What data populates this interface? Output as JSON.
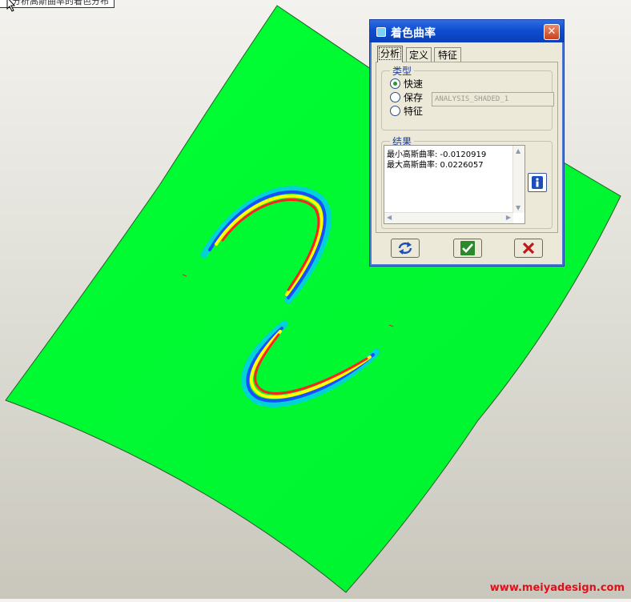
{
  "tooltip": {
    "text": "分析高斯曲率的着色分布"
  },
  "watermark": "www.meiyadesign.com",
  "colors": {
    "surface": "#00ff33",
    "title_bar": "#0f4ed0",
    "dialog_bg": "#ece9d8"
  },
  "dialog": {
    "title": "着色曲率",
    "tabs": [
      {
        "label": "分析",
        "active": true
      },
      {
        "label": "定义",
        "active": false
      },
      {
        "label": "特征",
        "active": false
      }
    ],
    "type_group": {
      "label": "类型",
      "options": [
        {
          "label": "快速",
          "checked": true
        },
        {
          "label": "保存",
          "checked": false
        },
        {
          "label": "特征",
          "checked": false
        }
      ],
      "save_name": "ANALYSIS_SHADED_1"
    },
    "results_group": {
      "label": "结果",
      "lines": [
        "最小高斯曲率: -0.0120919",
        "最大高斯曲率: 0.0226057"
      ]
    },
    "info_icon": "info-icon",
    "buttons": {
      "refresh": "refresh-icon",
      "ok": "checkmark-icon",
      "cancel": "x-icon"
    }
  }
}
